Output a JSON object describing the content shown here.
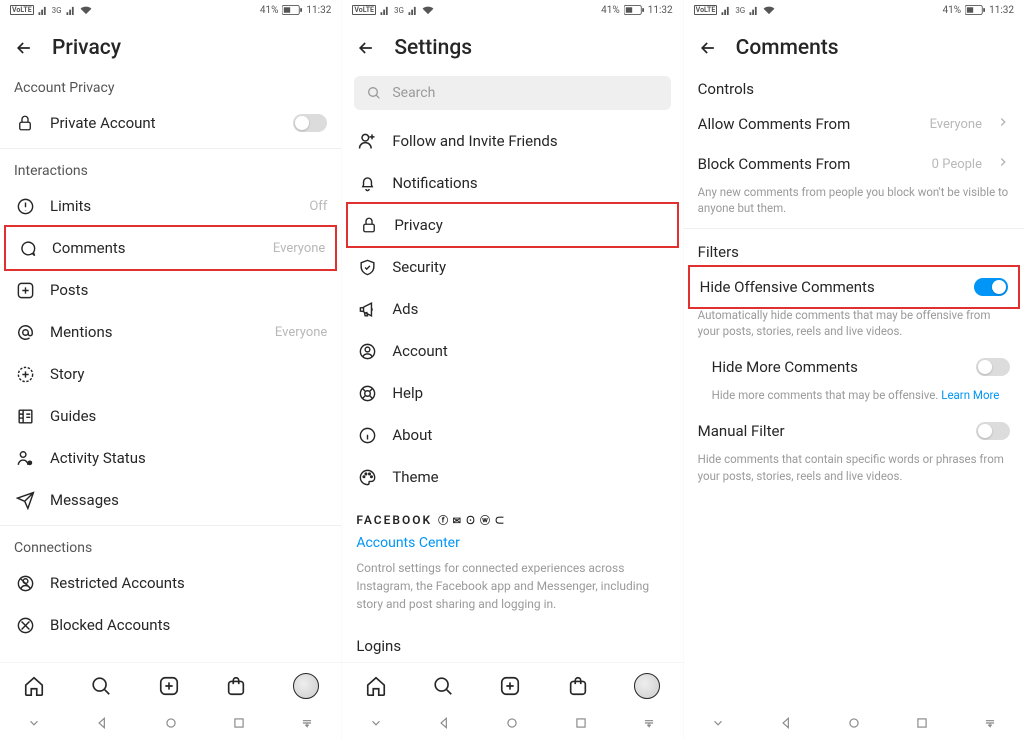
{
  "status": {
    "battery": "41%",
    "time": "11:32"
  },
  "screen1": {
    "title": "Privacy",
    "section_account": "Account Privacy",
    "private_account": "Private Account",
    "section_interactions": "Interactions",
    "limits": {
      "label": "Limits",
      "value": "Off"
    },
    "comments": {
      "label": "Comments",
      "value": "Everyone"
    },
    "posts": "Posts",
    "mentions": {
      "label": "Mentions",
      "value": "Everyone"
    },
    "story": "Story",
    "guides": "Guides",
    "activity_status": "Activity Status",
    "messages": "Messages",
    "section_connections": "Connections",
    "restricted": "Restricted Accounts",
    "blocked": "Blocked Accounts"
  },
  "screen2": {
    "title": "Settings",
    "search_placeholder": "Search",
    "items": {
      "follow": "Follow and Invite Friends",
      "notifications": "Notifications",
      "privacy": "Privacy",
      "security": "Security",
      "ads": "Ads",
      "account": "Account",
      "help": "Help",
      "about": "About",
      "theme": "Theme"
    },
    "fb_heading": "FACEBOOK",
    "accounts_center": "Accounts Center",
    "accounts_center_desc": "Control settings for connected experiences across Instagram, the Facebook app and Messenger, including story and post sharing and logging in.",
    "logins": "Logins"
  },
  "screen3": {
    "title": "Comments",
    "section_controls": "Controls",
    "allow": {
      "label": "Allow Comments From",
      "value": "Everyone"
    },
    "block": {
      "label": "Block Comments From",
      "value": "0 People"
    },
    "block_hint": "Any new comments from people you block won't be visible to anyone but them.",
    "section_filters": "Filters",
    "hide_offensive": "Hide Offensive Comments",
    "hide_offensive_hint": "Automatically hide comments that may be offensive from your posts, stories, reels and live videos.",
    "hide_more": "Hide More Comments",
    "hide_more_hint": "Hide more comments that may be offensive.",
    "learn_more": "Learn More",
    "manual_filter": "Manual Filter",
    "manual_filter_hint": "Hide comments that contain specific words or phrases from your posts, stories, reels and live videos."
  }
}
